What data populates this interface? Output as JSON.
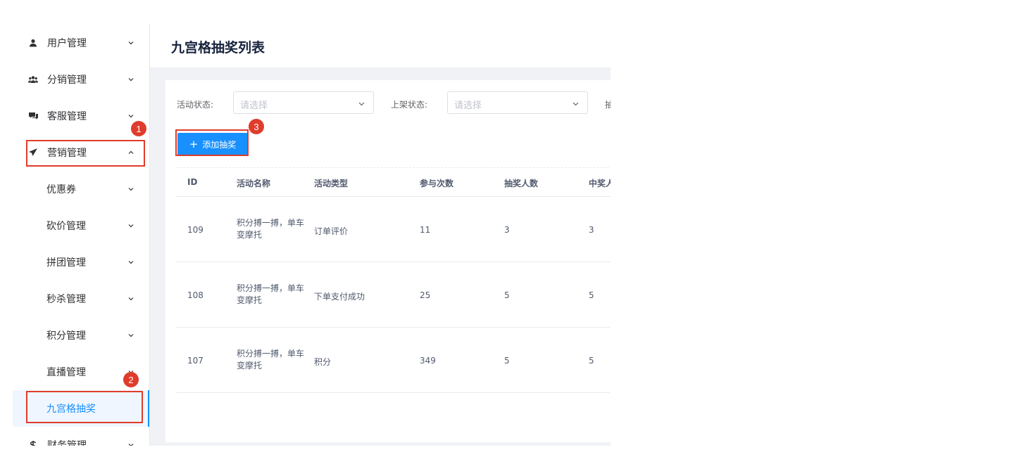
{
  "sidebar": {
    "items": [
      {
        "label": "用户管理",
        "icon": "user-icon",
        "expanded": false
      },
      {
        "label": "分销管理",
        "icon": "users-icon",
        "expanded": false
      },
      {
        "label": "客服管理",
        "icon": "chat-icon",
        "expanded": false
      },
      {
        "label": "营销管理",
        "icon": "send-icon",
        "expanded": true
      },
      {
        "label": "优惠券",
        "sub": true
      },
      {
        "label": "砍价管理",
        "sub": true
      },
      {
        "label": "拼团管理",
        "sub": true
      },
      {
        "label": "秒杀管理",
        "sub": true
      },
      {
        "label": "积分管理",
        "sub": true
      },
      {
        "label": "直播管理",
        "sub": true
      },
      {
        "label": "九宫格抽奖",
        "sub": true,
        "active": true
      },
      {
        "label": "财务管理",
        "icon": "dollar-icon",
        "expanded": false
      }
    ]
  },
  "header": {
    "title": "九宫格抽奖列表"
  },
  "filters": {
    "activity_status_label": "活动状态:",
    "activity_status_placeholder": "请选择",
    "shelf_status_label": "上架状态:",
    "shelf_status_placeholder": "请选择",
    "truncated_label": "抽"
  },
  "toolbar": {
    "add_label": "添加抽奖",
    "add_icon": "+"
  },
  "table": {
    "columns": [
      "ID",
      "活动名称",
      "活动类型",
      "参与次数",
      "抽奖人数",
      "中奖人"
    ],
    "rows": [
      {
        "id": "109",
        "name": "积分搏一搏，单车变摩托",
        "type": "订单评价",
        "participations": "11",
        "draw_count": "3",
        "winners": "3"
      },
      {
        "id": "108",
        "name": "积分搏一搏，单车变摩托",
        "type": "下单支付成功",
        "participations": "25",
        "draw_count": "5",
        "winners": "5"
      },
      {
        "id": "107",
        "name": "积分搏一搏，单车变摩托",
        "type": "积分",
        "participations": "349",
        "draw_count": "5",
        "winners": "5"
      }
    ]
  },
  "annotations": {
    "step1": "1",
    "step2": "2",
    "step3": "3"
  },
  "colors": {
    "accent": "#1890ff",
    "annotation": "#e03c2c"
  }
}
